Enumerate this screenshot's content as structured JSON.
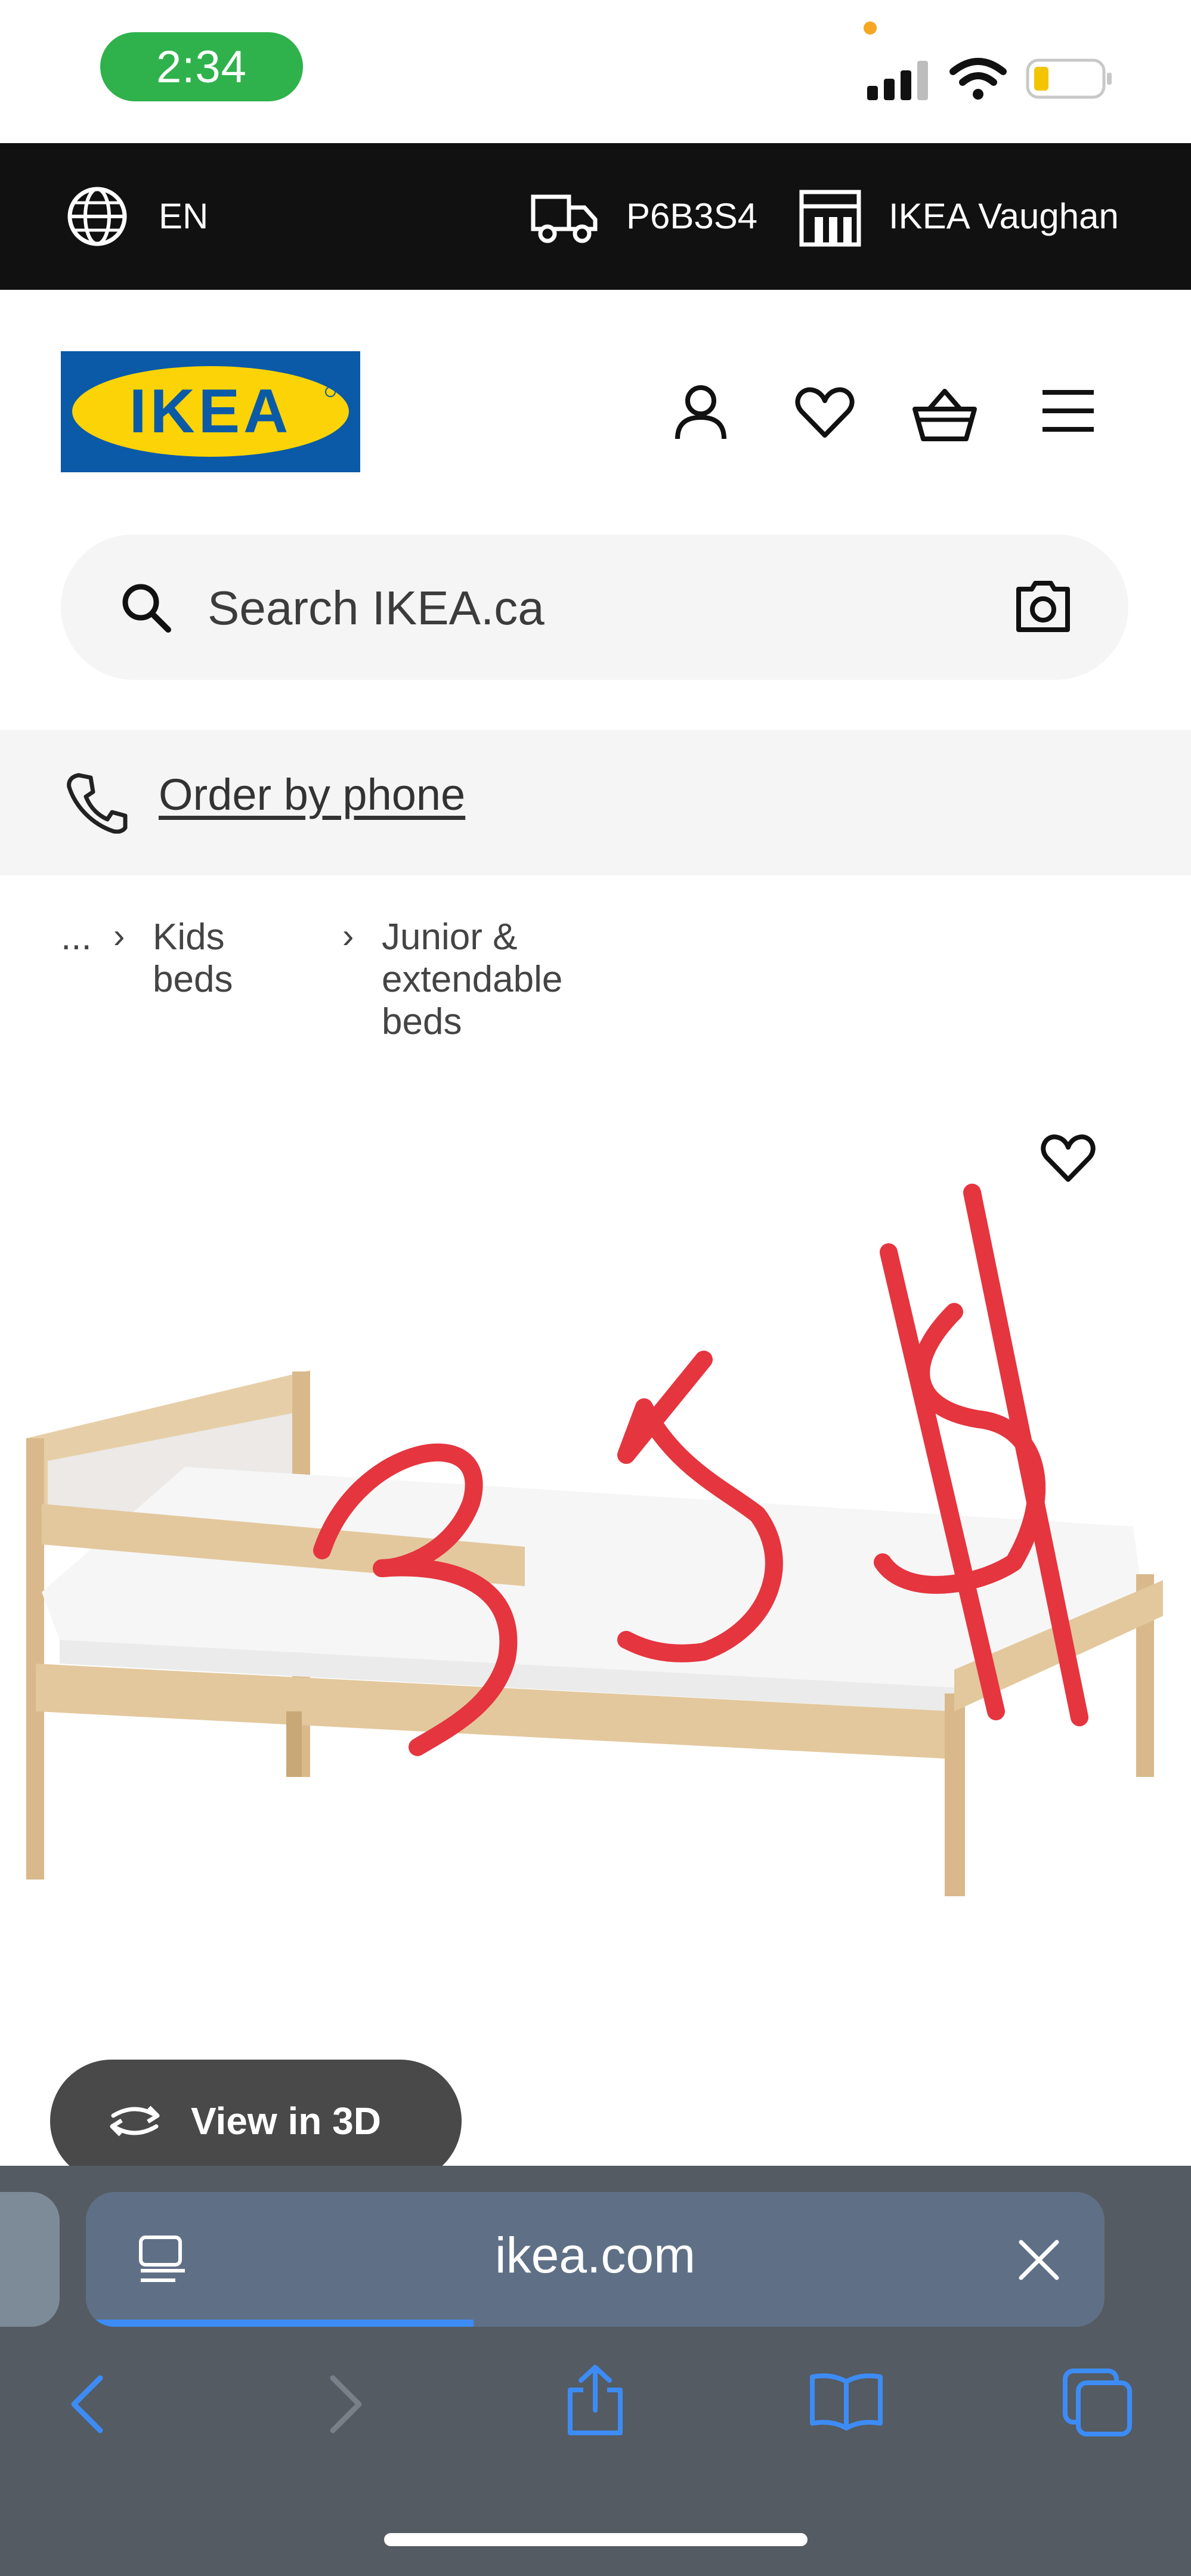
{
  "status_bar": {
    "time": "2:34",
    "battery_level": 0.2
  },
  "topbar": {
    "language": "EN",
    "postal_code": "P6B3S4",
    "store": "IKEA Vaughan"
  },
  "header": {
    "logo_text": "IKEA"
  },
  "search": {
    "placeholder": "Search IKEA.ca"
  },
  "order": {
    "label": "Order by phone"
  },
  "breadcrumb": {
    "ellipsis": "...",
    "items": [
      "Kids beds",
      "Junior & extendable beds"
    ]
  },
  "product": {
    "annotation": "354",
    "view3d_label": "View in 3D"
  },
  "browser": {
    "url": "ikea.com",
    "load_progress": 0.28
  },
  "colors": {
    "ikea_blue": "#0a5aa8",
    "ikea_yellow": "#fcd306",
    "annotation_red": "#e5353f",
    "safari_accent": "#3d8cf5"
  }
}
